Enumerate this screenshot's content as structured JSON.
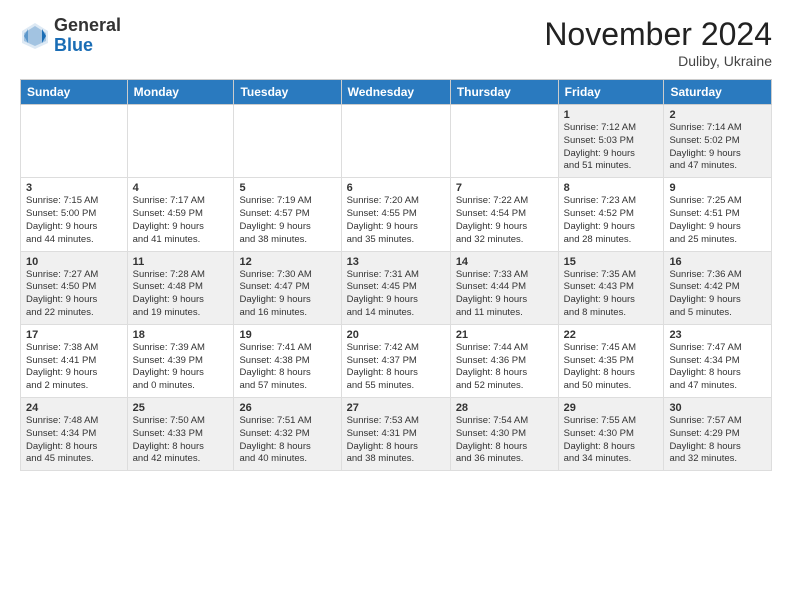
{
  "header": {
    "logo_general": "General",
    "logo_blue": "Blue",
    "month_title": "November 2024",
    "location": "Duliby, Ukraine"
  },
  "weekdays": [
    "Sunday",
    "Monday",
    "Tuesday",
    "Wednesday",
    "Thursday",
    "Friday",
    "Saturday"
  ],
  "rows": [
    [
      {
        "day": "",
        "info": ""
      },
      {
        "day": "",
        "info": ""
      },
      {
        "day": "",
        "info": ""
      },
      {
        "day": "",
        "info": ""
      },
      {
        "day": "",
        "info": ""
      },
      {
        "day": "1",
        "info": "Sunrise: 7:12 AM\nSunset: 5:03 PM\nDaylight: 9 hours\nand 51 minutes."
      },
      {
        "day": "2",
        "info": "Sunrise: 7:14 AM\nSunset: 5:02 PM\nDaylight: 9 hours\nand 47 minutes."
      }
    ],
    [
      {
        "day": "3",
        "info": "Sunrise: 7:15 AM\nSunset: 5:00 PM\nDaylight: 9 hours\nand 44 minutes."
      },
      {
        "day": "4",
        "info": "Sunrise: 7:17 AM\nSunset: 4:59 PM\nDaylight: 9 hours\nand 41 minutes."
      },
      {
        "day": "5",
        "info": "Sunrise: 7:19 AM\nSunset: 4:57 PM\nDaylight: 9 hours\nand 38 minutes."
      },
      {
        "day": "6",
        "info": "Sunrise: 7:20 AM\nSunset: 4:55 PM\nDaylight: 9 hours\nand 35 minutes."
      },
      {
        "day": "7",
        "info": "Sunrise: 7:22 AM\nSunset: 4:54 PM\nDaylight: 9 hours\nand 32 minutes."
      },
      {
        "day": "8",
        "info": "Sunrise: 7:23 AM\nSunset: 4:52 PM\nDaylight: 9 hours\nand 28 minutes."
      },
      {
        "day": "9",
        "info": "Sunrise: 7:25 AM\nSunset: 4:51 PM\nDaylight: 9 hours\nand 25 minutes."
      }
    ],
    [
      {
        "day": "10",
        "info": "Sunrise: 7:27 AM\nSunset: 4:50 PM\nDaylight: 9 hours\nand 22 minutes."
      },
      {
        "day": "11",
        "info": "Sunrise: 7:28 AM\nSunset: 4:48 PM\nDaylight: 9 hours\nand 19 minutes."
      },
      {
        "day": "12",
        "info": "Sunrise: 7:30 AM\nSunset: 4:47 PM\nDaylight: 9 hours\nand 16 minutes."
      },
      {
        "day": "13",
        "info": "Sunrise: 7:31 AM\nSunset: 4:45 PM\nDaylight: 9 hours\nand 14 minutes."
      },
      {
        "day": "14",
        "info": "Sunrise: 7:33 AM\nSunset: 4:44 PM\nDaylight: 9 hours\nand 11 minutes."
      },
      {
        "day": "15",
        "info": "Sunrise: 7:35 AM\nSunset: 4:43 PM\nDaylight: 9 hours\nand 8 minutes."
      },
      {
        "day": "16",
        "info": "Sunrise: 7:36 AM\nSunset: 4:42 PM\nDaylight: 9 hours\nand 5 minutes."
      }
    ],
    [
      {
        "day": "17",
        "info": "Sunrise: 7:38 AM\nSunset: 4:41 PM\nDaylight: 9 hours\nand 2 minutes."
      },
      {
        "day": "18",
        "info": "Sunrise: 7:39 AM\nSunset: 4:39 PM\nDaylight: 9 hours\nand 0 minutes."
      },
      {
        "day": "19",
        "info": "Sunrise: 7:41 AM\nSunset: 4:38 PM\nDaylight: 8 hours\nand 57 minutes."
      },
      {
        "day": "20",
        "info": "Sunrise: 7:42 AM\nSunset: 4:37 PM\nDaylight: 8 hours\nand 55 minutes."
      },
      {
        "day": "21",
        "info": "Sunrise: 7:44 AM\nSunset: 4:36 PM\nDaylight: 8 hours\nand 52 minutes."
      },
      {
        "day": "22",
        "info": "Sunrise: 7:45 AM\nSunset: 4:35 PM\nDaylight: 8 hours\nand 50 minutes."
      },
      {
        "day": "23",
        "info": "Sunrise: 7:47 AM\nSunset: 4:34 PM\nDaylight: 8 hours\nand 47 minutes."
      }
    ],
    [
      {
        "day": "24",
        "info": "Sunrise: 7:48 AM\nSunset: 4:34 PM\nDaylight: 8 hours\nand 45 minutes."
      },
      {
        "day": "25",
        "info": "Sunrise: 7:50 AM\nSunset: 4:33 PM\nDaylight: 8 hours\nand 42 minutes."
      },
      {
        "day": "26",
        "info": "Sunrise: 7:51 AM\nSunset: 4:32 PM\nDaylight: 8 hours\nand 40 minutes."
      },
      {
        "day": "27",
        "info": "Sunrise: 7:53 AM\nSunset: 4:31 PM\nDaylight: 8 hours\nand 38 minutes."
      },
      {
        "day": "28",
        "info": "Sunrise: 7:54 AM\nSunset: 4:30 PM\nDaylight: 8 hours\nand 36 minutes."
      },
      {
        "day": "29",
        "info": "Sunrise: 7:55 AM\nSunset: 4:30 PM\nDaylight: 8 hours\nand 34 minutes."
      },
      {
        "day": "30",
        "info": "Sunrise: 7:57 AM\nSunset: 4:29 PM\nDaylight: 8 hours\nand 32 minutes."
      }
    ]
  ]
}
